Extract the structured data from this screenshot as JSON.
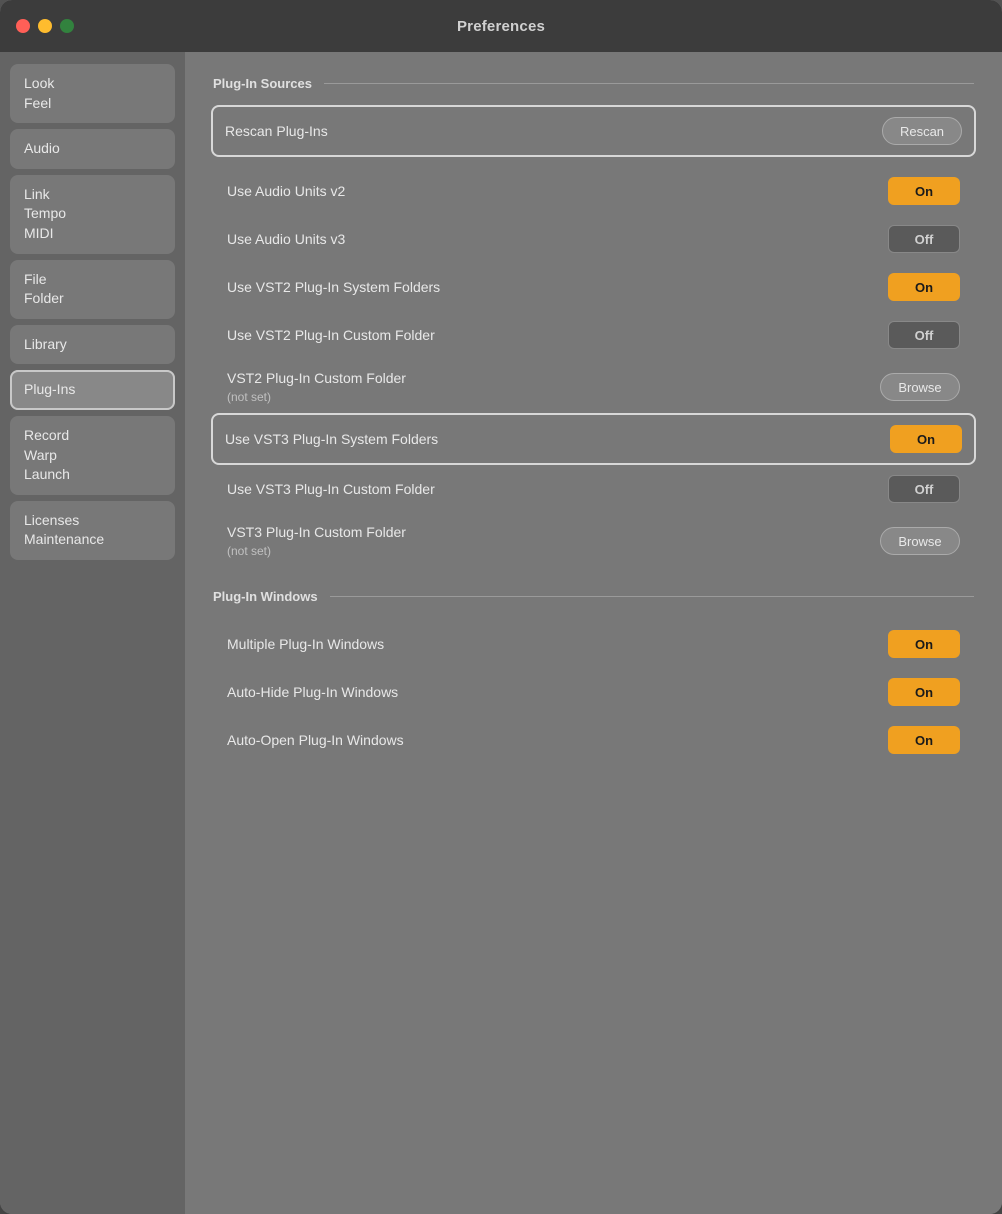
{
  "window": {
    "title": "Preferences"
  },
  "sidebar": {
    "items": [
      {
        "id": "look-feel",
        "label": "Look\nFeel",
        "active": false
      },
      {
        "id": "audio",
        "label": "Audio",
        "active": false
      },
      {
        "id": "link-tempo-midi",
        "label": "Link\nTempo\nMIDI",
        "active": false
      },
      {
        "id": "file-folder",
        "label": "File\nFolder",
        "active": false
      },
      {
        "id": "library",
        "label": "Library",
        "active": false
      },
      {
        "id": "plug-ins",
        "label": "Plug-Ins",
        "active": true
      },
      {
        "id": "record-warp-launch",
        "label": "Record\nWarp\nLaunch",
        "active": false
      },
      {
        "id": "licenses-maintenance",
        "label": "Licenses\nMaintenance",
        "active": false
      }
    ]
  },
  "panel": {
    "plug_in_sources_title": "Plug-In Sources",
    "plug_in_windows_title": "Plug-In Windows",
    "rows": {
      "rescan_label": "Rescan Plug-Ins",
      "rescan_btn": "Rescan",
      "audio_units_v2_label": "Use Audio Units v2",
      "audio_units_v2_value": "On",
      "audio_units_v3_label": "Use Audio Units v3",
      "audio_units_v3_value": "Off",
      "vst2_system_label": "Use VST2 Plug-In System Folders",
      "vst2_system_value": "On",
      "vst2_custom_label": "Use VST2 Plug-In Custom Folder",
      "vst2_custom_value": "Off",
      "vst2_custom_folder_label": "VST2 Plug-In Custom Folder",
      "vst2_custom_folder_sub": "(not set)",
      "vst2_browse_btn": "Browse",
      "vst3_system_label": "Use VST3 Plug-In System Folders",
      "vst3_system_value": "On",
      "vst3_custom_label": "Use VST3 Plug-In Custom Folder",
      "vst3_custom_value": "Off",
      "vst3_custom_folder_label": "VST3 Plug-In Custom Folder",
      "vst3_custom_folder_sub": "(not set)",
      "vst3_browse_btn": "Browse",
      "multiple_windows_label": "Multiple Plug-In Windows",
      "multiple_windows_value": "On",
      "auto_hide_label": "Auto-Hide Plug-In Windows",
      "auto_hide_value": "On",
      "auto_open_label": "Auto-Open Plug-In Windows",
      "auto_open_value": "On"
    }
  }
}
